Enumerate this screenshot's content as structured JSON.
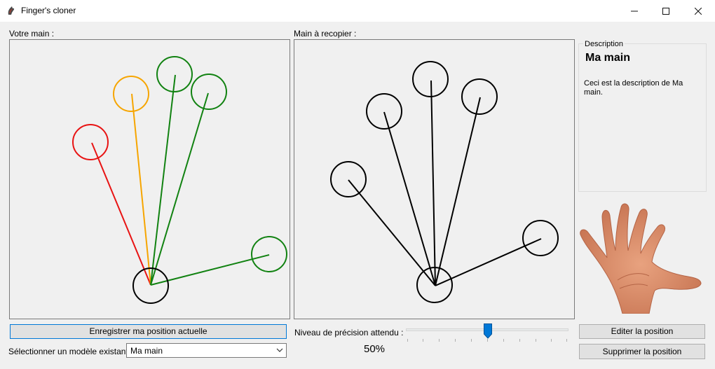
{
  "window": {
    "title": "Finger's cloner",
    "min_icon": "minimize-icon",
    "max_icon": "maximize-icon",
    "close_icon": "close-icon"
  },
  "labels": {
    "your_hand": "Votre main :",
    "target_hand": "Main à recopier :",
    "precision": "Niveau de précision attendu :",
    "select_model": "Sélectionner un modèle existant :"
  },
  "description": {
    "legend": "Description",
    "title": "Ma main",
    "text": "Ceci est la description de Ma main."
  },
  "buttons": {
    "save": "Enregistrer ma position actuelle",
    "edit": "Editer la position",
    "delete": "Supprimer la position"
  },
  "model_select": {
    "value": "Ma main"
  },
  "precision": {
    "value": 50,
    "display": "50%"
  },
  "colors": {
    "red": "#e81313",
    "orange": "#f6a500",
    "green": "#118211",
    "black": "#000000",
    "accent": "#0078d7"
  }
}
